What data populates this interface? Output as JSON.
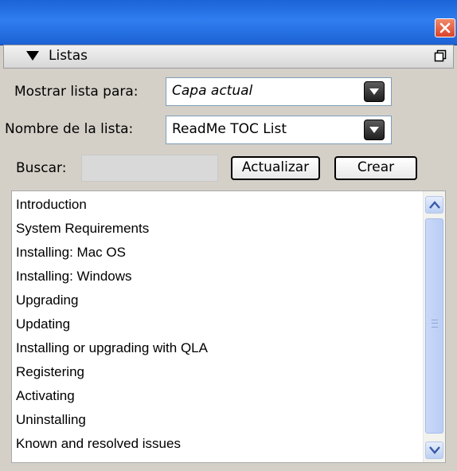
{
  "window": {
    "close_icon": "close-icon"
  },
  "palette": {
    "title": "Listas",
    "collapse_icon": "triangle-down-icon",
    "menu_icon": "palette-menu-icon"
  },
  "show_list_for": {
    "label": "Mostrar lista para:",
    "value": "Capa actual"
  },
  "list_name": {
    "label": "Nombre de la lista:",
    "value": "ReadMe TOC List"
  },
  "search": {
    "label": "Buscar:",
    "value": ""
  },
  "buttons": {
    "update": "Actualizar",
    "create": "Crear"
  },
  "items": [
    "Introduction",
    "System Requirements",
    "Installing: Mac OS",
    "Installing: Windows",
    "Upgrading",
    "Updating",
    "Installing or upgrading with QLA",
    "Registering",
    "Activating",
    "Uninstalling",
    "Known and resolved issues"
  ],
  "colors": {
    "titlebar": "#2f7ef0",
    "panel": "#d4d0c8",
    "close": "#d9432a"
  }
}
